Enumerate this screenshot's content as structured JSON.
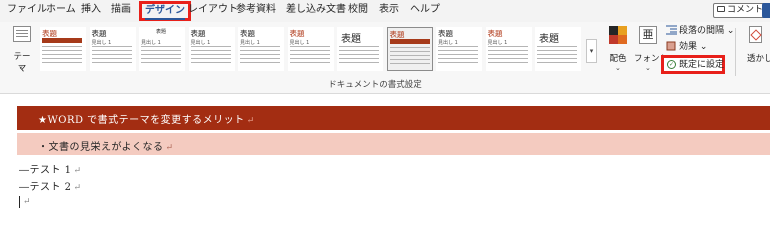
{
  "menu": {
    "tabs": [
      "ファイル",
      "ホーム",
      "挿入",
      "描画",
      "デザイン",
      "レイアウト",
      "参考資料",
      "差し込み文書",
      "校閲",
      "表示",
      "ヘルプ"
    ],
    "active_tab": "デザイン",
    "comment_label": "コメント"
  },
  "ribbon": {
    "theme_label": "テーマ",
    "gallery": {
      "group_label": "ドキュメントの書式設定",
      "items": [
        {
          "title": "表題",
          "sub": ""
        },
        {
          "title": "表題",
          "sub": "見出し 1"
        },
        {
          "title": "表題",
          "sub": "見出し 1"
        },
        {
          "title": "表題",
          "sub": "見出し 1"
        },
        {
          "title": "表題",
          "sub": "見出し 1"
        },
        {
          "title": "表題",
          "sub": "見出し 1"
        },
        {
          "title": "表題",
          "sub": ""
        },
        {
          "title": "表題",
          "sub": ""
        },
        {
          "title": "表題",
          "sub": "見出し 1"
        },
        {
          "title": "表題",
          "sub": "見出し 1"
        },
        {
          "title": "表題",
          "sub": ""
        }
      ]
    },
    "colors_label": "配色",
    "fonts_label": "フォント",
    "paragraph_spacing_label": "段落の間隔",
    "effects_label": "効果",
    "set_default_label": "既定に設定",
    "watermark_label": "透かし"
  },
  "document": {
    "heading1": "★WORD で書式テーマを変更するメリット",
    "heading2": "・文書の見栄えがよくなる",
    "lines": [
      "―テスト 1",
      "―テスト 2"
    ],
    "para_mark": "↵"
  },
  "colors": {
    "heading1_band": "#a32d12",
    "heading2_band": "#f4cbc0",
    "highlight_box": "#e8201a",
    "active_tab_text": "#2b579a"
  }
}
